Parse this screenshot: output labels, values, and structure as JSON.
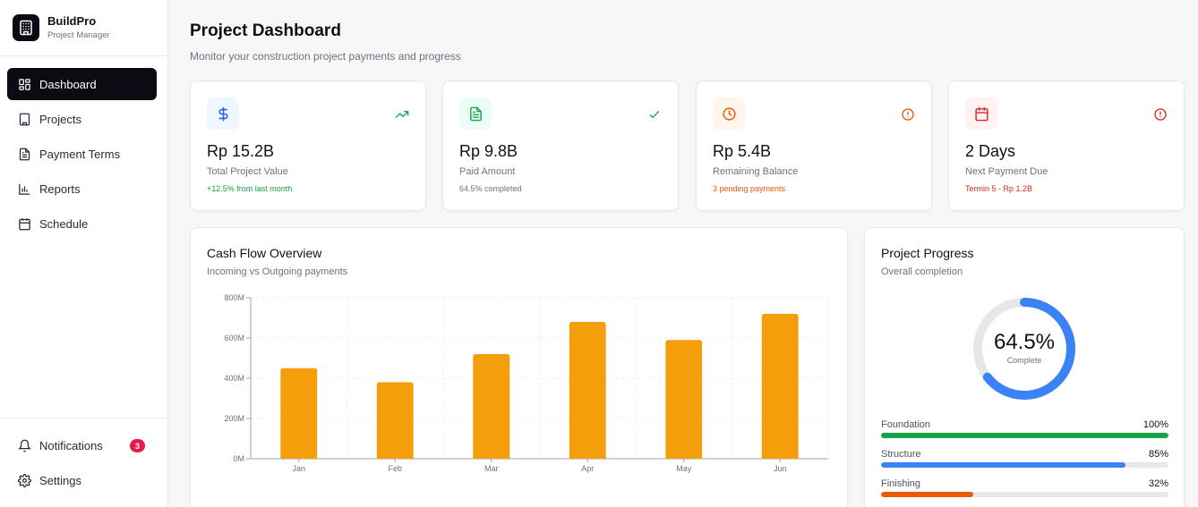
{
  "brand": {
    "name": "BuildPro",
    "subtitle": "Project Manager"
  },
  "nav": {
    "items": [
      {
        "label": "Dashboard",
        "icon": "grid-icon",
        "active": true
      },
      {
        "label": "Projects",
        "icon": "building-icon"
      },
      {
        "label": "Payment Terms",
        "icon": "document-icon"
      },
      {
        "label": "Reports",
        "icon": "bar-chart-icon"
      },
      {
        "label": "Schedule",
        "icon": "calendar-icon"
      }
    ],
    "bottom": [
      {
        "label": "Notifications",
        "icon": "bell-icon",
        "badge": "3"
      },
      {
        "label": "Settings",
        "icon": "gear-icon"
      }
    ]
  },
  "header": {
    "title": "Project Dashboard",
    "subtitle": "Monitor your construction project payments and progress"
  },
  "stats": [
    {
      "value": "Rp 15.2B",
      "label": "Total Project Value",
      "note": "+12.5% from last month",
      "icon": "dollar-icon",
      "trend_icon": "trending-up-icon",
      "accent": "#2563eb",
      "note_color": "#16a34a"
    },
    {
      "value": "Rp 9.8B",
      "label": "Paid Amount",
      "note": "64.5% completed",
      "icon": "document-icon",
      "trend_icon": "check-icon",
      "accent": "#16a34a",
      "note_color": "#6b7280"
    },
    {
      "value": "Rp 5.4B",
      "label": "Remaining Balance",
      "note": "3 pending payments",
      "icon": "clock-icon",
      "trend_icon": "alert-circle-icon",
      "accent": "#ea580c",
      "note_color": "#ea580c"
    },
    {
      "value": "2 Days",
      "label": "Next Payment Due",
      "note": "Termin 5 - Rp 1.2B",
      "icon": "calendar-icon",
      "trend_icon": "alert-circle-icon",
      "accent": "#dc2626",
      "note_color": "#dc2626"
    }
  ],
  "cashflow": {
    "title": "Cash Flow Overview",
    "subtitle": "Incoming vs Outgoing payments"
  },
  "chart_data": {
    "type": "bar",
    "categories": [
      "Jan",
      "Feb",
      "Mar",
      "Apr",
      "May",
      "Jun"
    ],
    "values": [
      450,
      380,
      520,
      680,
      590,
      720
    ],
    "y_ticks": [
      "0M",
      "200M",
      "400M",
      "600M",
      "800M"
    ],
    "ylim": [
      0,
      800
    ],
    "grid": true,
    "bar_color": "#f59e0b"
  },
  "progress": {
    "title": "Project Progress",
    "subtitle": "Overall completion",
    "percent_label": "64.5%",
    "percent": 64.5,
    "complete_label": "Complete",
    "ring_color": "#3b82f6",
    "phases": [
      {
        "name": "Foundation",
        "value_label": "100%",
        "value": 100,
        "color": "#16a34a"
      },
      {
        "name": "Structure",
        "value_label": "85%",
        "value": 85,
        "color": "#3b82f6"
      },
      {
        "name": "Finishing",
        "value_label": "32%",
        "value": 32,
        "color": "#ea580c"
      }
    ]
  }
}
